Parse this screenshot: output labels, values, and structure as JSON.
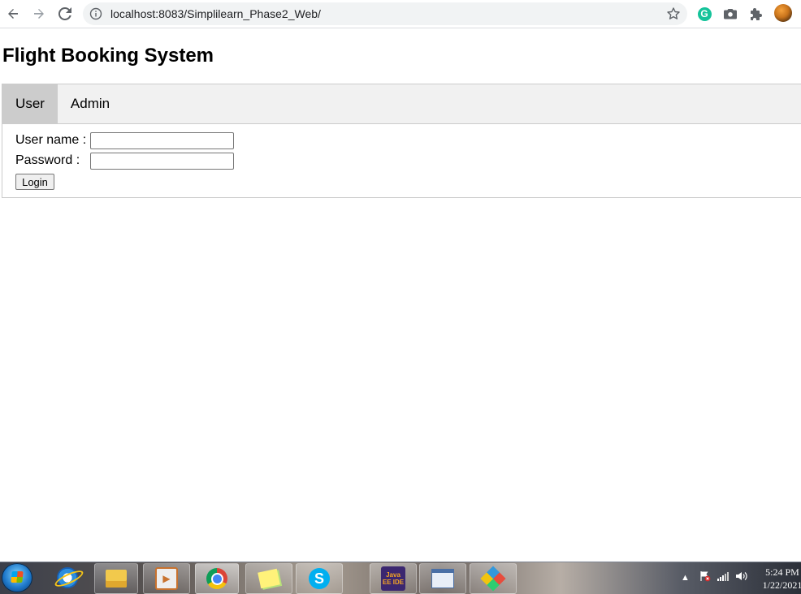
{
  "browser": {
    "url": "localhost:8083/Simplilearn_Phase2_Web/",
    "back_icon": "back-arrow-icon",
    "forward_icon": "forward-arrow-icon",
    "reload_icon": "reload-icon",
    "extension_icons": [
      "grammarly-icon",
      "camera-icon",
      "puzzle-extensions-icon"
    ],
    "grammarly_letter": "G"
  },
  "page": {
    "title": "Flight Booking System",
    "tabs": [
      {
        "label": "User",
        "active": true
      },
      {
        "label": "Admin",
        "active": false
      }
    ],
    "form": {
      "username_label": "User name :",
      "username_value": "",
      "password_label": "Password :",
      "password_value": "",
      "login_label": "Login"
    }
  },
  "taskbar": {
    "pinned": [
      "windows-start-icon",
      "internet-explorer-icon",
      "file-explorer-icon",
      "media-player-icon",
      "chrome-icon",
      "sticky-notes-icon",
      "skype-icon",
      "java-ee-ide-icon",
      "window-app-icon",
      "diamond-app-icon"
    ],
    "skype_letter": "S",
    "javaee_label": "Java EE IDE",
    "clock_time": "5:24 PM",
    "clock_date": "1/22/2021"
  },
  "colors": {
    "tab_bar_bg": "#f1f1f1",
    "tab_active_bg": "#cccccc",
    "border": "#cccccc",
    "omnibox_bg": "#f1f3f4"
  }
}
